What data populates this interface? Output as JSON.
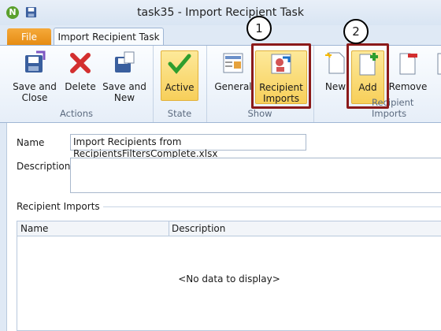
{
  "window": {
    "title": "task35 - Import Recipient Task"
  },
  "tabs": {
    "file": "File",
    "active": "Import Recipient Task"
  },
  "ribbon": {
    "actions": {
      "label": "Actions",
      "save_close": "Save and\nClose",
      "delete": "Delete",
      "save_new": "Save and\nNew"
    },
    "state": {
      "label": "State",
      "active": "Active"
    },
    "show": {
      "label": "Show",
      "general": "General",
      "recipient_imports": "Recipient\nImports"
    },
    "recipient_imports_group": {
      "label": "Recipient Imports",
      "new": "New",
      "add": "Add",
      "remove": "Remove"
    }
  },
  "annotations": {
    "step1": "1",
    "step2": "2"
  },
  "form": {
    "name_label": "Name",
    "name_value": "Import Recipients from RecipientsFiltersComplete.xlsx",
    "description_label": "Description",
    "description_value": "",
    "section_label": "Recipient Imports",
    "grid": {
      "columns": [
        "Name",
        "Description"
      ],
      "empty_text": "<No data to display>"
    }
  },
  "colors": {
    "accent_orange": "#e58b12",
    "highlight": "#f7cf5a",
    "callout_border": "#8b1a1a"
  }
}
